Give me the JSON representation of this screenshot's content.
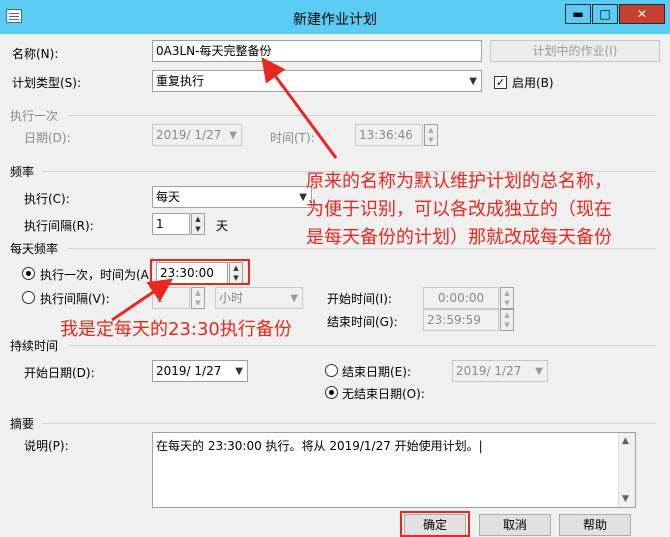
{
  "window": {
    "title": "新建作业计划",
    "minimize": "▬",
    "maximize": "□",
    "close": "✕"
  },
  "name_row": {
    "label": "名称(N):",
    "value": "0A3LN-每天完整备份",
    "jobs_button": "计划中的作业(I)"
  },
  "plan_type": {
    "label": "计划类型(S):",
    "value": "重复执行",
    "enabled_label": "启用(B)",
    "enabled_check": "✓"
  },
  "once": {
    "group": "执行一次",
    "date_label": "日期(D):",
    "date_value": "2019/ 1/27",
    "time_label": "时间(T):",
    "time_value": "13:36:46"
  },
  "frequency": {
    "group": "频率",
    "exec_label": "执行(C):",
    "exec_value": "每天",
    "interval_label": "执行间隔(R):",
    "interval_value": "1",
    "interval_unit": "天"
  },
  "daily": {
    "group": "每天频率",
    "once_label": "执行一次，时间为(A",
    "once_time": "23:30:00",
    "interval_label": "执行间隔(V):",
    "interval_value": "1",
    "interval_unit": "小时",
    "start_label": "开始时间(I):",
    "start_value": "0:00:00",
    "end_label": "结束时间(G):",
    "end_value": "23:59:59"
  },
  "duration": {
    "group": "持续时间",
    "start_label": "开始日期(D):",
    "start_value": "2019/ 1/27",
    "end_label": "结束日期(E):",
    "end_value": "2019/ 1/27",
    "no_end_label": "无结束日期(O):"
  },
  "summary": {
    "group": "摘要",
    "desc_label": "说明(P):",
    "desc_value": "在每天的 23:30:00 执行。将从 2019/1/27 开始使用计划。|"
  },
  "buttons": {
    "ok": "确定",
    "cancel": "取消",
    "help": "帮助"
  },
  "annotations": {
    "note1_line1": "原来的名称为默认维护计划的总名称，",
    "note1_line2": "为便于识别，可以各改成独立的（现在",
    "note1_line3": "是每天备份的计划）那就改成每天备份",
    "note2": "我是定每天的23:30执行备份"
  },
  "colors": {
    "titlebar": "#5bcdf5",
    "annotation": "#e8281e"
  }
}
